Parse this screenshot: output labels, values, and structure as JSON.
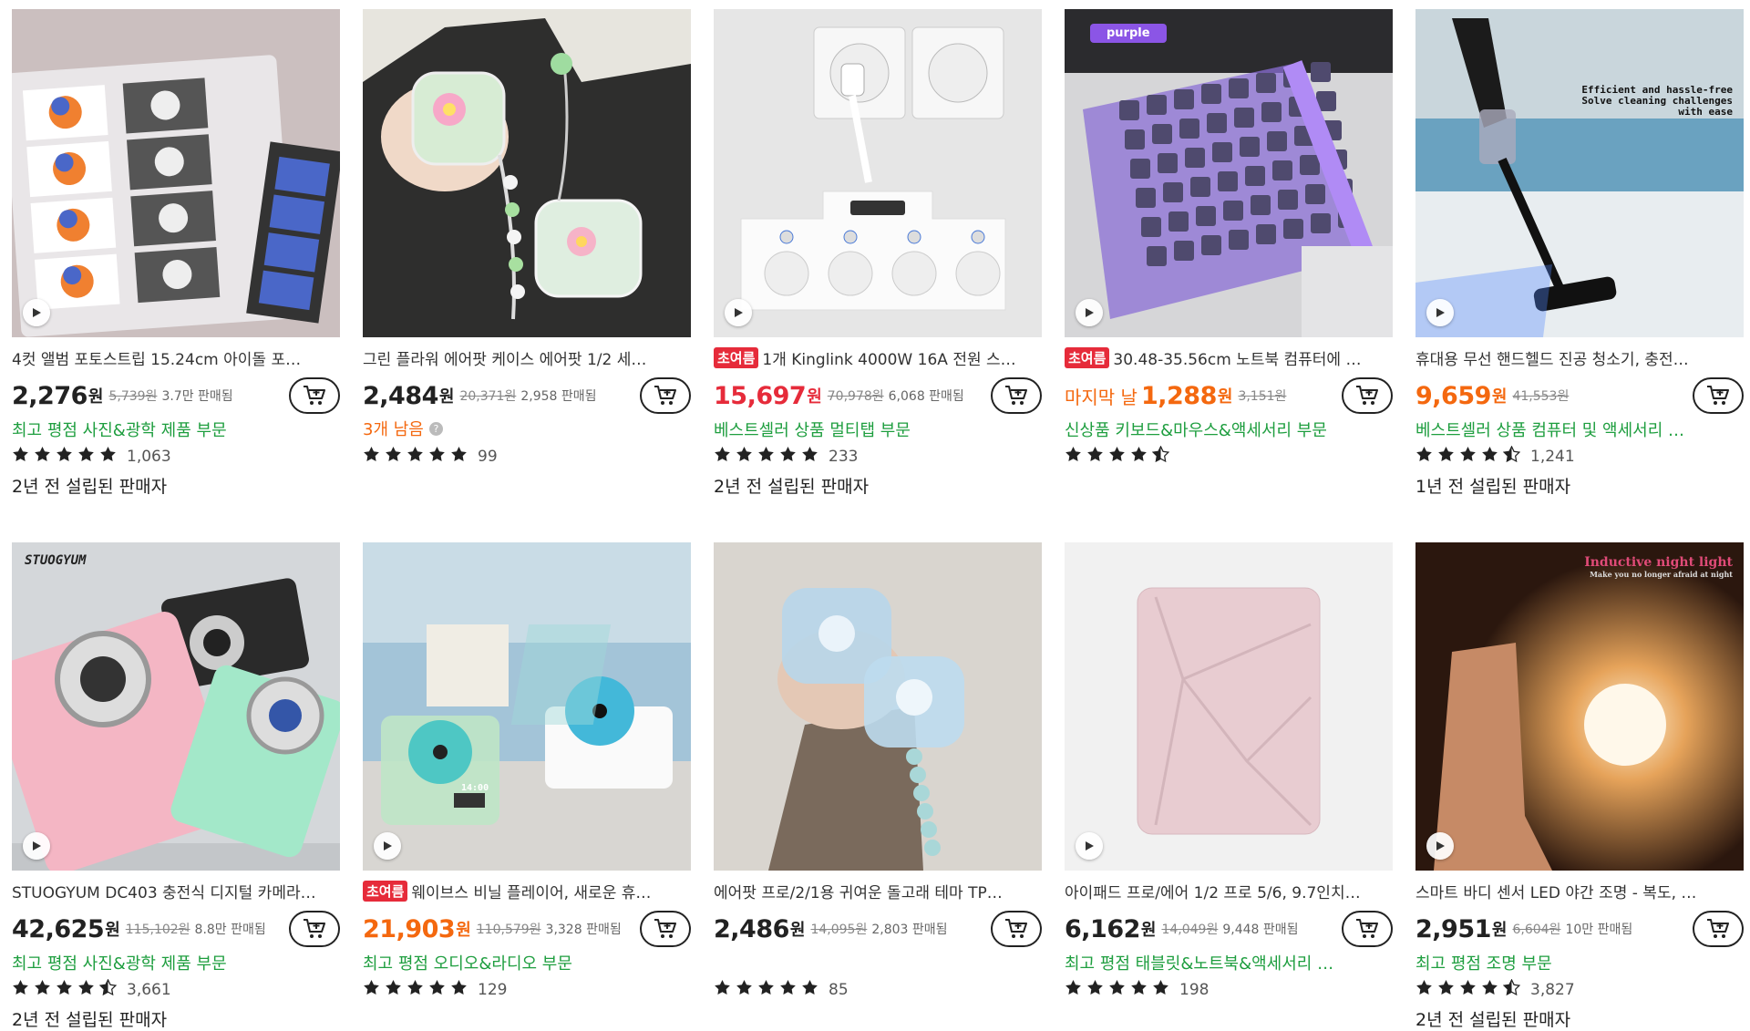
{
  "products": [
    {
      "title": "4컷 앨범 포토스트립 15.24cm 아이돌 포…",
      "badge": "",
      "price": "2,276",
      "price_style": "normal",
      "currency": "원",
      "orig_price": "5,739원",
      "sold": "3.7만 판매됨",
      "prefix": "",
      "category": "최고 평점 사진&광학 제품 부문",
      "stock": "",
      "rating": 5,
      "reviews": "1,063",
      "seller": "2년 전 설립된 판매자",
      "play": true,
      "image": {
        "bg": "#d9cfd0",
        "accent": "#f0f0f0",
        "art": "album"
      }
    },
    {
      "title": "그린 플라워 에어팟 케이스 에어팟 1/2 세…",
      "badge": "",
      "price": "2,484",
      "price_style": "normal",
      "currency": "원",
      "orig_price": "20,371원",
      "sold": "2,958 판매됨",
      "prefix": "",
      "category": "",
      "stock": "3개 남음",
      "rating": 5,
      "reviews": "99",
      "seller": "",
      "play": false,
      "image": {
        "bg": "#e4e2da",
        "accent": "#cfe9c2",
        "art": "airpods-green"
      }
    },
    {
      "title": "1개 Kinglink 4000W 16A 전원 스…",
      "badge": "초여름",
      "price": "15,697",
      "price_style": "red",
      "currency": "원",
      "orig_price": "70,978원",
      "sold": "6,068 판매됨",
      "prefix": "",
      "category": "베스트셀러 상품 멀티탭 부문",
      "stock": "",
      "rating": 5,
      "reviews": "233",
      "seller": "2년 전 설립된 판매자",
      "play": true,
      "image": {
        "bg": "#e8e8e8",
        "accent": "#ffffff",
        "art": "socket"
      }
    },
    {
      "title": "30.48-35.56cm 노트북 컴퓨터에 …",
      "badge": "초여름",
      "price": "1,288",
      "price_style": "orange",
      "currency": "원",
      "orig_price": "3,151원",
      "sold": "",
      "prefix": "마지막 날",
      "category": "신상품 키보드&마우스&액세서리 부문",
      "stock": "",
      "rating": 4.5,
      "reviews": "",
      "seller": "",
      "play": true,
      "image": {
        "bg": "#c9c9cc",
        "accent": "#a07ee6",
        "art": "keyboard",
        "tag": "purple"
      }
    },
    {
      "title": "휴대용 무선 핸드헬드 진공 청소기, 충전…",
      "badge": "",
      "price": "9,659",
      "price_style": "orange",
      "currency": "원",
      "orig_price": "41,553원",
      "sold": "",
      "prefix": "bolt",
      "category": "베스트셀러 상품 컴퓨터 및 액세서리 …",
      "stock": "",
      "rating": 4.5,
      "reviews": "1,241",
      "seller": "1년 전 설립된 판매자",
      "play": true,
      "image": {
        "bg": "#b8cbd6",
        "accent": "#222222",
        "art": "vacuum",
        "caption": [
          "Efficient and hassle-free",
          "Solve cleaning challenges",
          "with ease"
        ]
      }
    },
    {
      "title": "STUOGYUM DC403 충전식 디지털 카메라…",
      "badge": "",
      "price": "42,625",
      "price_style": "normal",
      "currency": "원",
      "orig_price": "115,102원",
      "sold": "8.8만 판매됨",
      "prefix": "",
      "category": "최고 평점 사진&광학 제품 부문",
      "stock": "",
      "rating": 4.5,
      "reviews": "3,661",
      "seller": "2년 전 설립된 판매자",
      "play": true,
      "image": {
        "bg": "#d6d9dc",
        "accent": "#f2b9c9",
        "art": "camera",
        "brand": "STUOGYUM"
      }
    },
    {
      "title": "웨이브스 비닐 플레이어, 새로운 휴…",
      "badge": "초여름",
      "price": "21,903",
      "price_style": "orange",
      "currency": "원",
      "orig_price": "110,579원",
      "sold": "3,328 판매됨",
      "prefix": "",
      "category": "최고 평점 오디오&라디오 부문",
      "stock": "",
      "rating": 5,
      "reviews": "129",
      "seller": "",
      "play": true,
      "image": {
        "bg": "#a9c7d8",
        "accent": "#5fd6d2",
        "art": "vinyl",
        "display": "14:00"
      }
    },
    {
      "title": "에어팟 프로/2/1용 귀여운 돌고래 테마 TP…",
      "badge": "",
      "price": "2,486",
      "price_style": "normal",
      "currency": "원",
      "orig_price": "14,095원",
      "sold": "2,803 판매됨",
      "prefix": "",
      "category": "",
      "stock": "",
      "rating": 5,
      "reviews": "85",
      "seller": "",
      "play": false,
      "image": {
        "bg": "#d8d4cf",
        "accent": "#a9cde6",
        "art": "dolphin"
      }
    },
    {
      "title": "아이패드 프로/에어 1/2 프로 5/6, 9.7인치…",
      "badge": "",
      "price": "6,162",
      "price_style": "normal",
      "currency": "원",
      "orig_price": "14,049원",
      "sold": "9,448 판매됨",
      "prefix": "",
      "category": "최고 평점 태블릿&노트북&액세서리 …",
      "stock": "",
      "rating": 5,
      "reviews": "198",
      "seller": "",
      "play": true,
      "image": {
        "bg": "#f1f1f1",
        "accent": "#e8cfd3",
        "art": "ipad"
      }
    },
    {
      "title": "스마트 바디 센서 LED 야간 조명 - 복도, …",
      "badge": "",
      "price": "2,951",
      "price_style": "normal",
      "currency": "원",
      "orig_price": "6,604원",
      "sold": "10만 판매됨",
      "prefix": "",
      "category": "최고 평점 조명 부문",
      "stock": "",
      "rating": 4.5,
      "reviews": "3,827",
      "seller": "2년 전 설립된 판매자",
      "play": true,
      "image": {
        "bg": "#3a2418",
        "accent": "#ffd9a0",
        "art": "nightlight",
        "caption": [
          "Inductive night light",
          "Make you no longer afraid at night"
        ]
      }
    }
  ],
  "colors": {
    "sale_red": "#e62b3a",
    "orange": "#f4680f",
    "green": "#1e9e3f"
  },
  "icons": {
    "cart": "cart-plus-icon",
    "play": "play-icon",
    "flame": "flame-icon",
    "star": "star-icon",
    "calendar": "calendar-check-icon",
    "bolt": "lightning-icon"
  }
}
